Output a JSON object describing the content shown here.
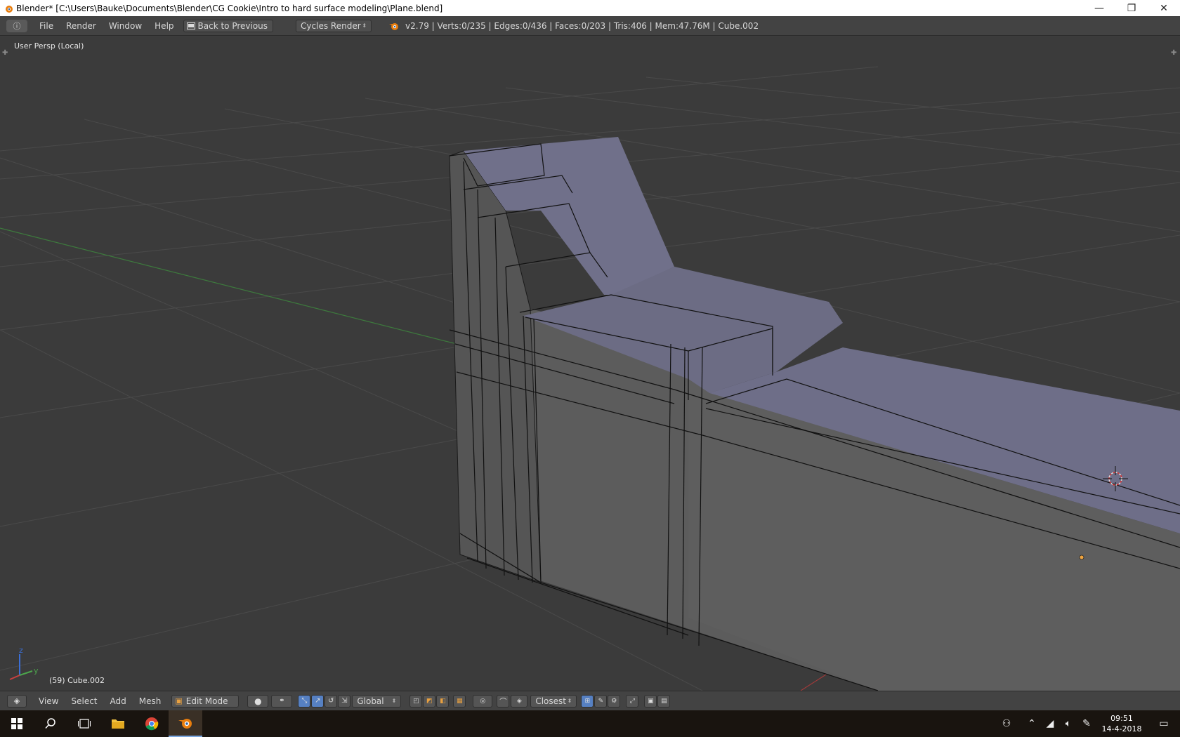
{
  "window": {
    "title": "Blender* [C:\\Users\\Bauke\\Documents\\Blender\\CG Cookie\\Intro to hard surface modeling\\Plane.blend]",
    "minimize": "—",
    "restore": "❐",
    "close": "✕"
  },
  "info_header": {
    "menu": [
      "File",
      "Render",
      "Window",
      "Help"
    ],
    "back_button": "Back to Previous",
    "render_engine": "Cycles Render",
    "stats": "v2.79 | Verts:0/235 | Edges:0/436 | Faces:0/203 | Tris:406 | Mem:47.76M | Cube.002"
  },
  "viewport": {
    "view_label": "User Persp (Local)",
    "object_label": "(59) Cube.002",
    "axes": {
      "z": "z",
      "y": "y"
    }
  },
  "footer": {
    "menu": [
      "View",
      "Select",
      "Add",
      "Mesh"
    ],
    "mode": "Edit Mode",
    "orientation": "Global",
    "snap_target": "Closest"
  },
  "taskbar": {
    "time": "09:51",
    "date": "14-4-2018"
  },
  "colors": {
    "accent": "#5680c2",
    "viewport_bg": "#3b3b3b",
    "header_bg": "#434343",
    "mesh_top": "#6e6e82"
  }
}
